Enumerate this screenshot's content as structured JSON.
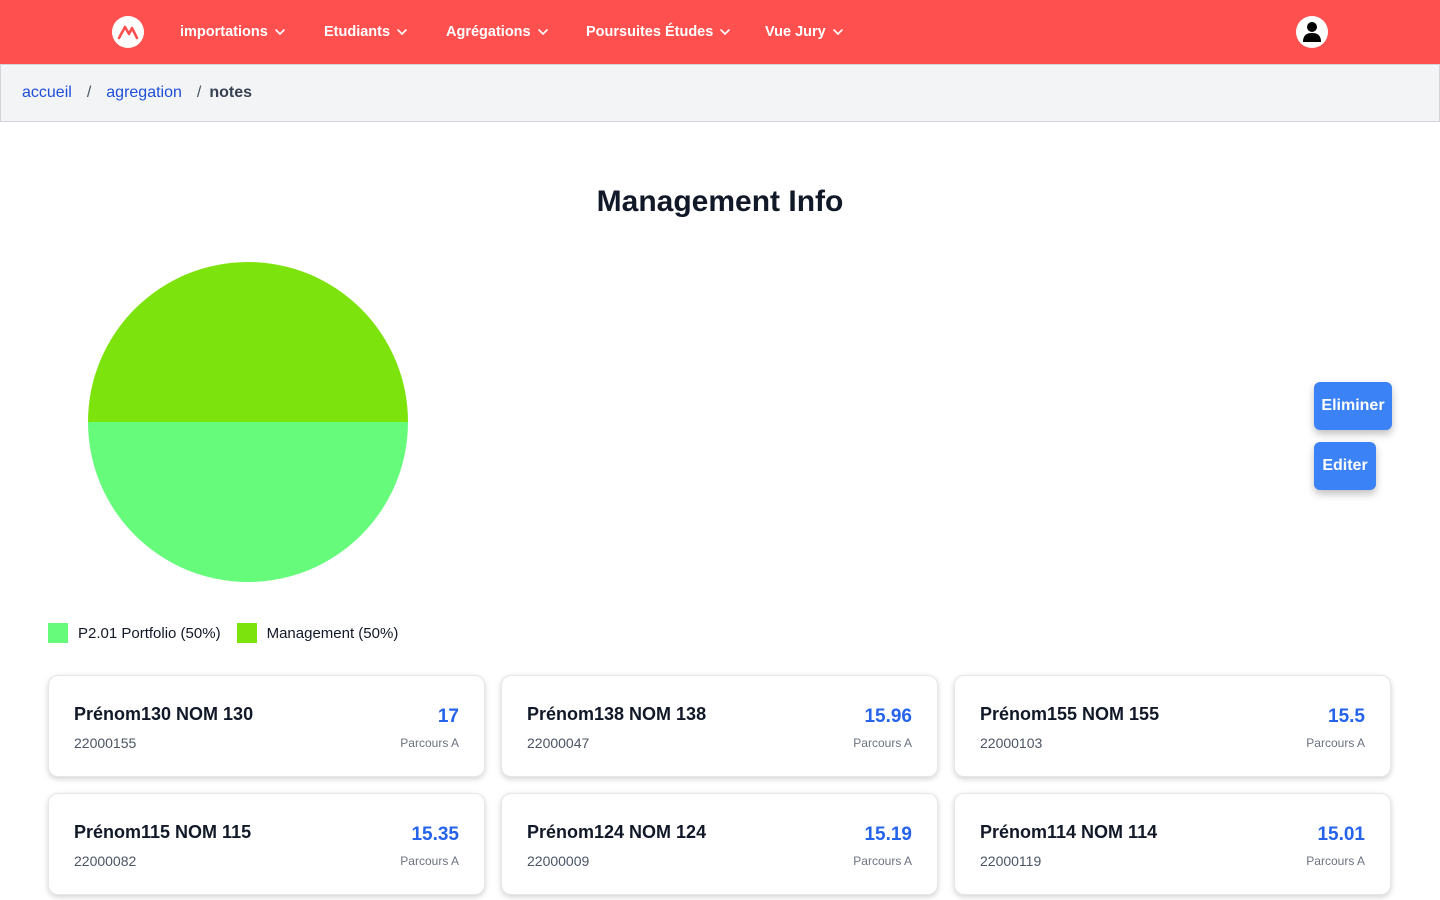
{
  "colors": {
    "navbar": "#ff5050",
    "link": "#1d4ed8",
    "score": "#2563eb",
    "button": "#3b82f6",
    "slice_portfolio": "#66fb7b",
    "slice_management": "#7de30c"
  },
  "nav": {
    "logo_icon": "logo-icon",
    "items": [
      {
        "label": "importations"
      },
      {
        "label": "Etudiants"
      },
      {
        "label": "Agrégations"
      },
      {
        "label": "Poursuites Études"
      },
      {
        "label": "Vue Jury"
      }
    ],
    "user_icon": "user-icon"
  },
  "breadcrumb": {
    "items": [
      {
        "label": "accueil"
      },
      {
        "label": "agregation"
      },
      {
        "label": "notes"
      }
    ],
    "separator": "/"
  },
  "page": {
    "title": "Management Info"
  },
  "chart_data": {
    "type": "pie",
    "title": "",
    "legend_position": "bottom-left",
    "slices": [
      {
        "label": "P2.01 Portfolio",
        "value": 50,
        "color": "#66fb7b"
      },
      {
        "label": "Management",
        "value": 50,
        "color": "#7de30c"
      }
    ],
    "legend": [
      {
        "label": "P2.01 Portfolio (50%)"
      },
      {
        "label": "Management (50%)"
      }
    ]
  },
  "actions": {
    "eliminer_label": "Eliminer",
    "editer_label": "Editer"
  },
  "students": [
    {
      "name": "Prénom130 NOM 130",
      "id": "22000155",
      "score": "17",
      "parcours": "Parcours A"
    },
    {
      "name": "Prénom138 NOM 138",
      "id": "22000047",
      "score": "15.96",
      "parcours": "Parcours A"
    },
    {
      "name": "Prénom155 NOM 155",
      "id": "22000103",
      "score": "15.5",
      "parcours": "Parcours A"
    },
    {
      "name": "Prénom115 NOM 115",
      "id": "22000082",
      "score": "15.35",
      "parcours": "Parcours A"
    },
    {
      "name": "Prénom124 NOM 124",
      "id": "22000009",
      "score": "15.19",
      "parcours": "Parcours A"
    },
    {
      "name": "Prénom114 NOM 114",
      "id": "22000119",
      "score": "15.01",
      "parcours": "Parcours A"
    }
  ]
}
